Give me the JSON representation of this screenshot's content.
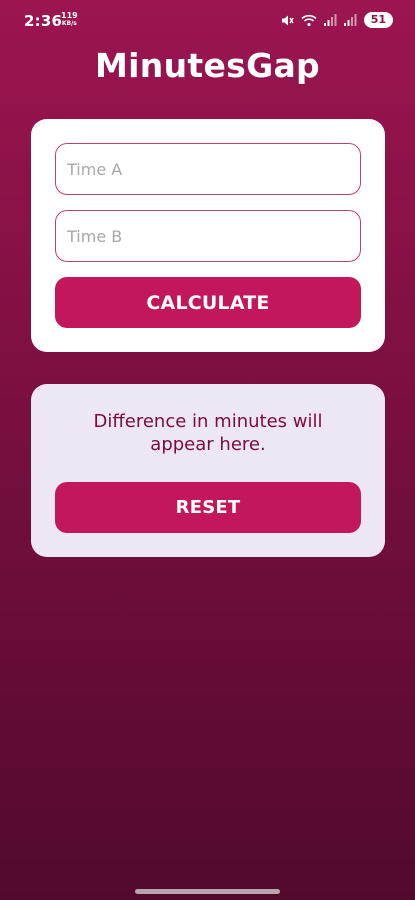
{
  "status_bar": {
    "time": "2:36",
    "speed_value": "119",
    "speed_unit": "KB/s",
    "battery": "51",
    "icons": [
      "mute-icon",
      "wifi-icon",
      "signal-icon",
      "signal-icon-2"
    ]
  },
  "app": {
    "title": "MinutesGap"
  },
  "input_card": {
    "time_a_placeholder": "Time A",
    "time_a_value": "",
    "time_b_placeholder": "Time B",
    "time_b_value": "",
    "calculate_label": "CALCULATE"
  },
  "result_card": {
    "message": "Difference in minutes will appear here.",
    "reset_label": "RESET"
  },
  "colors": {
    "background_top": "#9c1550",
    "background_bottom": "#520a2b",
    "accent": "#c2185b",
    "result_text": "#7d0b3c",
    "result_card": "#ede6f3"
  }
}
